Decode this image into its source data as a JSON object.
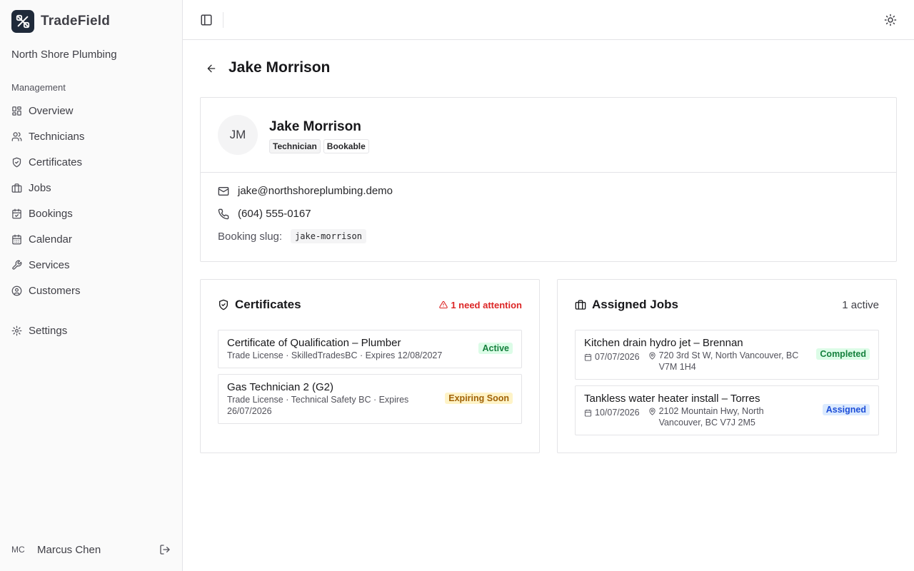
{
  "app": {
    "name": "TradeField",
    "organization": "North Shore Plumbing"
  },
  "sidebar": {
    "section_label": "Management",
    "items": [
      {
        "label": "Overview",
        "icon": "layout-dashboard-icon"
      },
      {
        "label": "Technicians",
        "icon": "users-icon"
      },
      {
        "label": "Certificates",
        "icon": "shield-check-icon"
      },
      {
        "label": "Jobs",
        "icon": "briefcase-icon"
      },
      {
        "label": "Bookings",
        "icon": "calendar-check-icon"
      },
      {
        "label": "Calendar",
        "icon": "calendar-icon"
      },
      {
        "label": "Services",
        "icon": "wrench-icon"
      },
      {
        "label": "Customers",
        "icon": "user-circle-icon"
      }
    ],
    "settings_label": "Settings",
    "user": {
      "initials": "MC",
      "name": "Marcus Chen"
    }
  },
  "page": {
    "title": "Jake Morrison"
  },
  "profile": {
    "initials": "JM",
    "name": "Jake Morrison",
    "badges": [
      "Technician",
      "Bookable"
    ],
    "email": "jake@northshoreplumbing.demo",
    "phone": "(604) 555-0167",
    "slug_label": "Booking slug:",
    "slug": "jake-morrison"
  },
  "certificates": {
    "title": "Certificates",
    "attention": "1 need attention",
    "items": [
      {
        "title": "Certificate of Qualification –  Plumber",
        "sub": "Trade License · SkilledTradesBC · Expires 12/08/2027",
        "status": "Active"
      },
      {
        "title": "Gas Technician 2 (G2)",
        "sub": "Trade License · Technical Safety BC · Expires 26/07/2026",
        "status": "Expiring Soon"
      }
    ]
  },
  "jobs": {
    "title": "Assigned Jobs",
    "active_count": "1 active",
    "items": [
      {
        "title": "Kitchen drain hydro jet –  Brennan",
        "date": "07/07/2026",
        "address": "720 3rd St W, North Vancouver, BC V7M 1H4",
        "status": "Completed"
      },
      {
        "title": "Tankless water heater install –  Torres",
        "date": "10/07/2026",
        "address": "2102 Mountain Hwy, North Vancouver, BC V7J 2M5",
        "status": "Assigned"
      }
    ]
  },
  "colors": {
    "accent_danger": "#dc2626",
    "status_active": "#15803d",
    "status_expiring": "#a16207",
    "status_assigned": "#1d4ed8",
    "logo_bg": "#1f2a3a"
  }
}
